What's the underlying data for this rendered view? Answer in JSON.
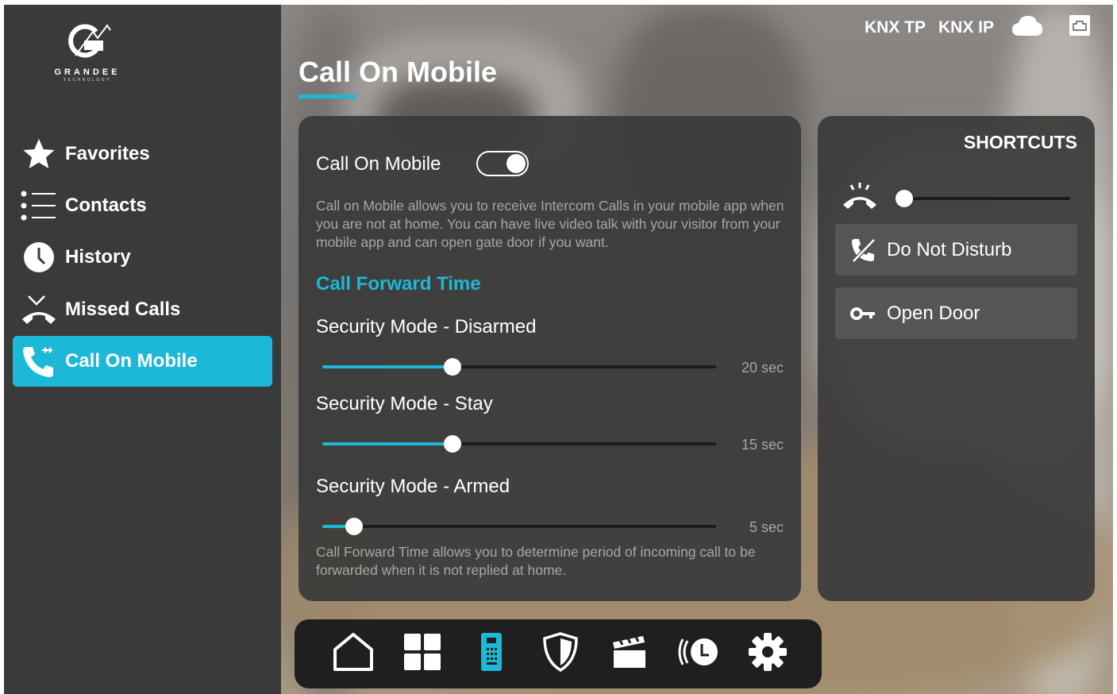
{
  "brand": {
    "name": "GRANDEE",
    "tagline": "TECHNOLOGY"
  },
  "sidebar": {
    "items": [
      {
        "label": "Favorites",
        "icon": "star-icon",
        "active": false
      },
      {
        "label": "Contacts",
        "icon": "list-icon",
        "active": false
      },
      {
        "label": "History",
        "icon": "clock-icon",
        "active": false
      },
      {
        "label": "Missed Calls",
        "icon": "missed-call-icon",
        "active": false
      },
      {
        "label": "Call On Mobile",
        "icon": "phone-forward-icon",
        "active": true
      }
    ]
  },
  "header": {
    "title": "Call On Mobile",
    "status": {
      "knx_tp": "KNX TP",
      "knx_ip": "KNX IP",
      "cloud_icon": "cloud-icon",
      "network_icon": "ethernet-icon"
    }
  },
  "main": {
    "call_on_mobile": {
      "label": "Call On Mobile",
      "enabled": true,
      "description": "Call on Mobile allows you to receive Intercom Calls in your mobile app when you are not at home. You can have live video talk with your visitor from your mobile app and can open gate door if you want."
    },
    "call_forward": {
      "title": "Call Forward Time",
      "modes": [
        {
          "label": "Security Mode - Disarmed",
          "value_text": "20 sec",
          "level": 0.33
        },
        {
          "label": "Security Mode - Stay",
          "value_text": "15 sec",
          "level": 0.33
        },
        {
          "label": "Security Mode - Armed",
          "value_text": "5 sec",
          "level": 0.08
        }
      ],
      "description": "Call Forward Time allows you to determine period of incoming call to be forwarded when it is not replied at home."
    }
  },
  "shortcuts": {
    "title": "SHORTCUTS",
    "ringer_level": 0.0,
    "buttons": [
      {
        "label": "Do Not Disturb",
        "icon": "do-not-disturb-icon"
      },
      {
        "label": "Open Door",
        "icon": "key-icon"
      }
    ]
  },
  "dock": {
    "items": [
      {
        "icon": "home-icon",
        "active": false
      },
      {
        "icon": "grid-icon",
        "active": false
      },
      {
        "icon": "intercom-icon",
        "active": true
      },
      {
        "icon": "shield-icon",
        "active": false
      },
      {
        "icon": "scene-icon",
        "active": false
      },
      {
        "icon": "schedule-icon",
        "active": false
      },
      {
        "icon": "settings-icon",
        "active": false
      }
    ]
  },
  "colors": {
    "accent": "#1cb8d8",
    "panel": "#3a3a3a",
    "text_muted": "#a6a6a6"
  }
}
